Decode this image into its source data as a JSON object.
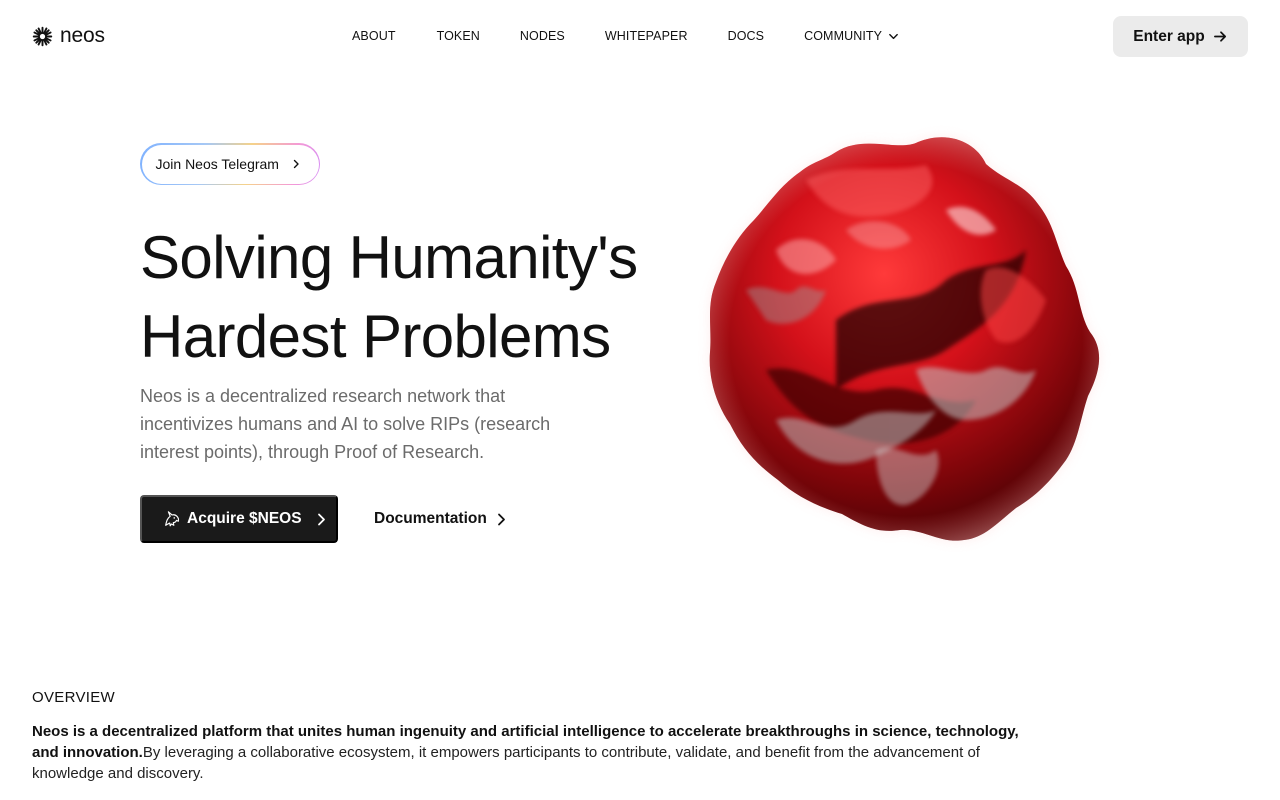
{
  "brand": {
    "name": "neos"
  },
  "nav": {
    "items": [
      {
        "label": "ABOUT"
      },
      {
        "label": "TOKEN"
      },
      {
        "label": "NODES"
      },
      {
        "label": "WHITEPAPER"
      },
      {
        "label": "DOCS"
      },
      {
        "label": "COMMUNITY",
        "icon": "chevron-down-icon"
      }
    ]
  },
  "header": {
    "enter_app_label": "Enter app",
    "enter_app_icon": "arrow-right-icon"
  },
  "hero": {
    "telegram_label": "Join Neos Telegram",
    "title_line1": "Solving Humanity's",
    "title_line2": "Hardest Problems",
    "description": "Neos is a decentralized research network that incentivizes humans and AI to solve RIPs (research interest points), through Proof of Research.",
    "acquire_label": "Acquire $NEOS",
    "acquire_icon": "unicorn-icon",
    "docs_label": "Documentation",
    "image": "red-3d-blob-sphere"
  },
  "overview": {
    "label": "OVERVIEW",
    "lead": "Neos is a decentralized platform that unites human ingenuity and artificial intelligence to accelerate breakthroughs in science, technology, and innovation.",
    "body": "By leveraging a collaborative ecosystem, it empowers participants to contribute, validate, and benefit from the advancement of knowledge and discovery."
  },
  "colors": {
    "primary_button_bg": "#1a1a1a",
    "secondary_button_bg": "#ebebeb",
    "muted_text": "#6b6b6b",
    "blob_red": "#c8101a"
  }
}
